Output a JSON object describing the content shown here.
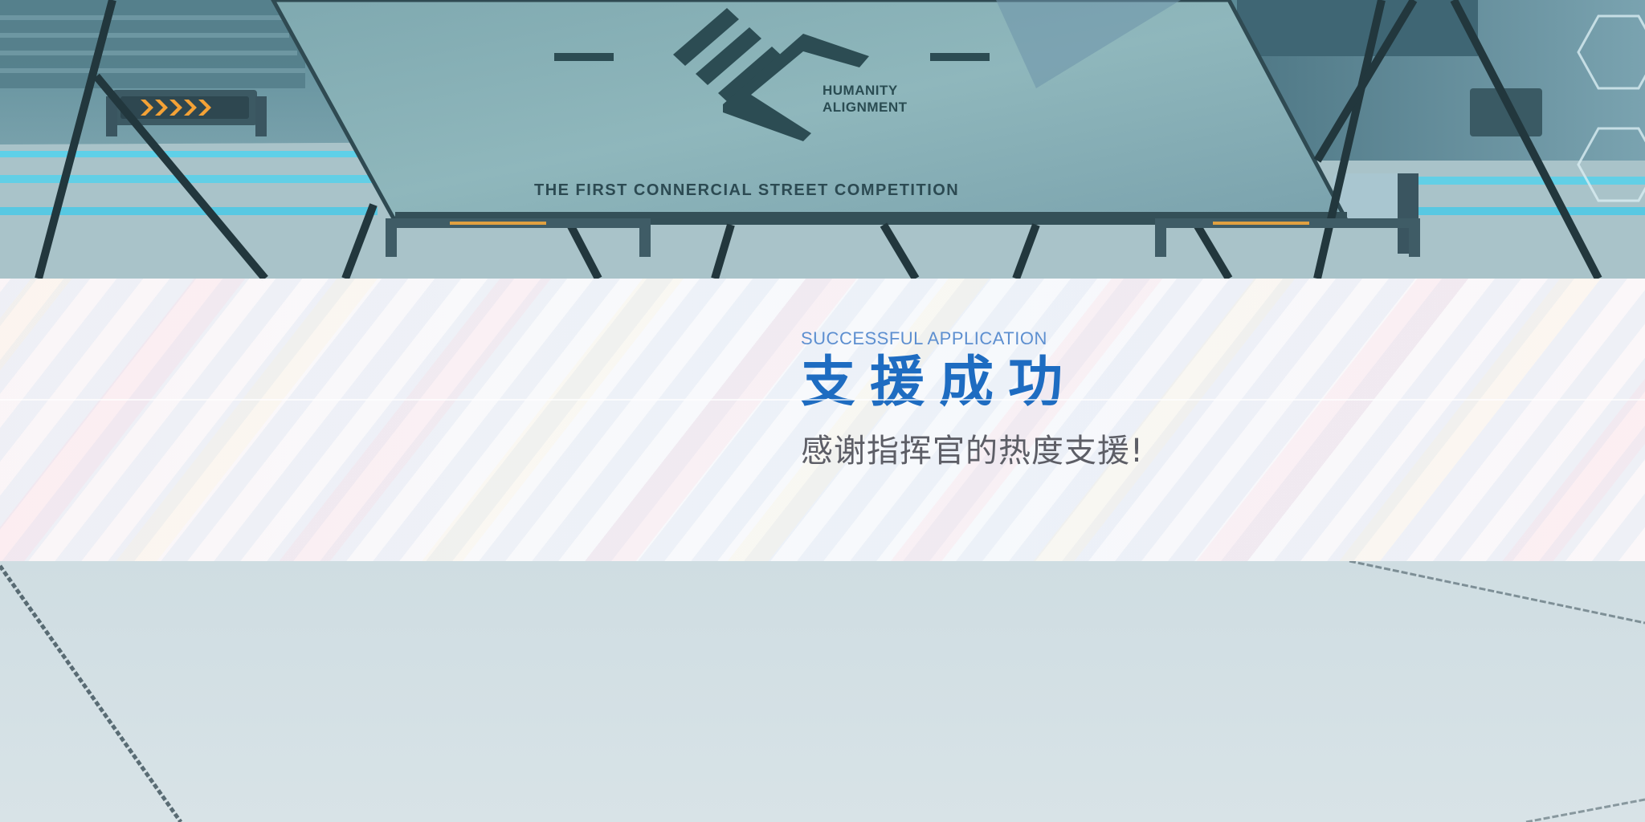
{
  "scene": {
    "sign": {
      "brand_line1": "HUMANITY",
      "brand_line2": "ALIGNMENT",
      "competition_title": "THE FIRST CONNERCIAL STREET COMPETITION",
      "logo_icon": "humanity-alignment-logo"
    }
  },
  "result": {
    "subtitle_en": "SUCCESSFUL APPLICATION",
    "title_cn": "支援成功",
    "message_cn": "感谢指挥官的热度支援!"
  },
  "colors": {
    "title": "#1e6cc1",
    "subtitle": "#5d8fd0",
    "message": "#5d5e66"
  }
}
